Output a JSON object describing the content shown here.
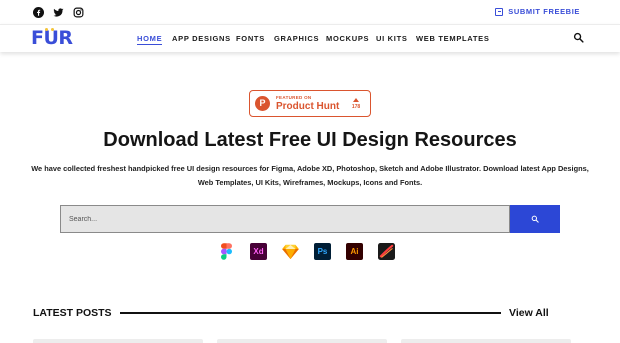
{
  "social": {
    "icons": [
      "facebook-icon",
      "twitter-icon",
      "instagram-icon"
    ]
  },
  "submit": {
    "label": "SUBMIT FREEBIE"
  },
  "brand": {
    "logo_prefix": "F",
    "logo_u": "U",
    "logo_suffix": "R",
    "color": "#3a4ed8",
    "dot_color": "#f4c43a"
  },
  "nav": {
    "items": [
      {
        "label": "HOME",
        "active": true
      },
      {
        "label": "APP DESIGNS",
        "active": false
      },
      {
        "label": "FONTS",
        "active": false
      },
      {
        "label": "GRAPHICS",
        "active": false
      },
      {
        "label": "MOCKUPS",
        "active": false
      },
      {
        "label": "UI KITS",
        "active": false
      },
      {
        "label": "WEB TEMPLATES",
        "active": false
      }
    ]
  },
  "product_hunt": {
    "letter": "P",
    "featured": "FEATURED ON",
    "name": "Product Hunt",
    "count": "178",
    "color": "#da552f"
  },
  "hero": {
    "title": "Download Latest Free UI Design Resources",
    "description": "We have collected freshest handpicked free UI design resources for Figma, Adobe XD, Photoshop, Sketch and Adobe Illustrator. Download latest App Designs, Web Templates, UI Kits, Wireframes, Mockups, Icons and Fonts."
  },
  "search": {
    "placeholder": "Search...",
    "button_color": "#2c47d6"
  },
  "tools": [
    {
      "name": "figma-icon",
      "label": ""
    },
    {
      "name": "adobe-xd-icon",
      "label": "Xd"
    },
    {
      "name": "sketch-icon",
      "label": ""
    },
    {
      "name": "photoshop-icon",
      "label": "Ps"
    },
    {
      "name": "illustrator-icon",
      "label": "Ai"
    },
    {
      "name": "affinity-icon",
      "label": ""
    }
  ],
  "latest": {
    "heading": "LATEST POSTS",
    "view_all": "View All"
  }
}
